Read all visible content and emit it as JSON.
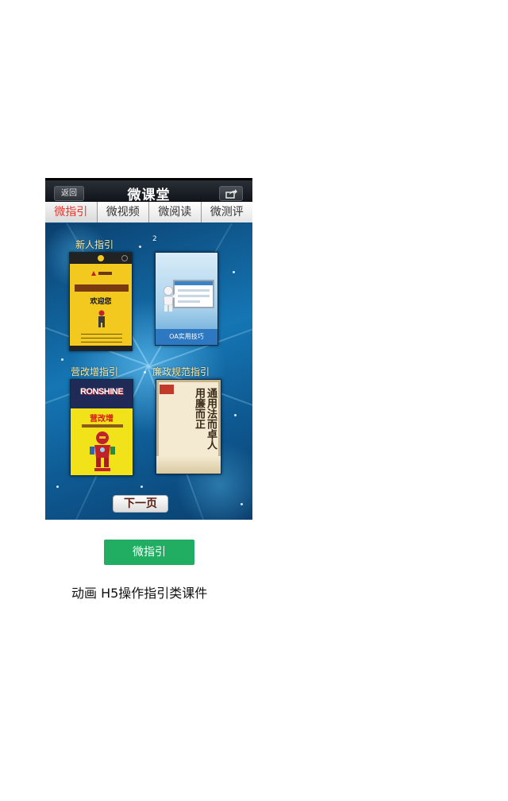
{
  "app": {
    "title": "微课堂",
    "back_label": "返回",
    "share_icon": "share-icon"
  },
  "tabs": [
    {
      "label": "微指引",
      "active": true
    },
    {
      "label": "微视频",
      "active": false
    },
    {
      "label": "微阅读",
      "active": false
    },
    {
      "label": "微测评",
      "active": false
    }
  ],
  "content": {
    "marker": "2",
    "sections": [
      {
        "label": "新人指引",
        "card": {
          "heading": "欢迎您"
        }
      },
      {
        "label": "",
        "card": {
          "caption": "OA实用技巧"
        }
      },
      {
        "label": "营改增指引",
        "card": {
          "brand": "RONSHINE",
          "slogan": "营改增"
        }
      },
      {
        "label": "廉政规范指引",
        "card": {
          "calligraphy": "通用法而卓人用廉而正"
        }
      }
    ],
    "next_label": "下一页"
  },
  "below": {
    "button_label": "微指引",
    "caption": "动画 H5操作指引类课件"
  },
  "colors": {
    "accent_green": "#21ad62",
    "active_tab_red": "#e8362e"
  }
}
